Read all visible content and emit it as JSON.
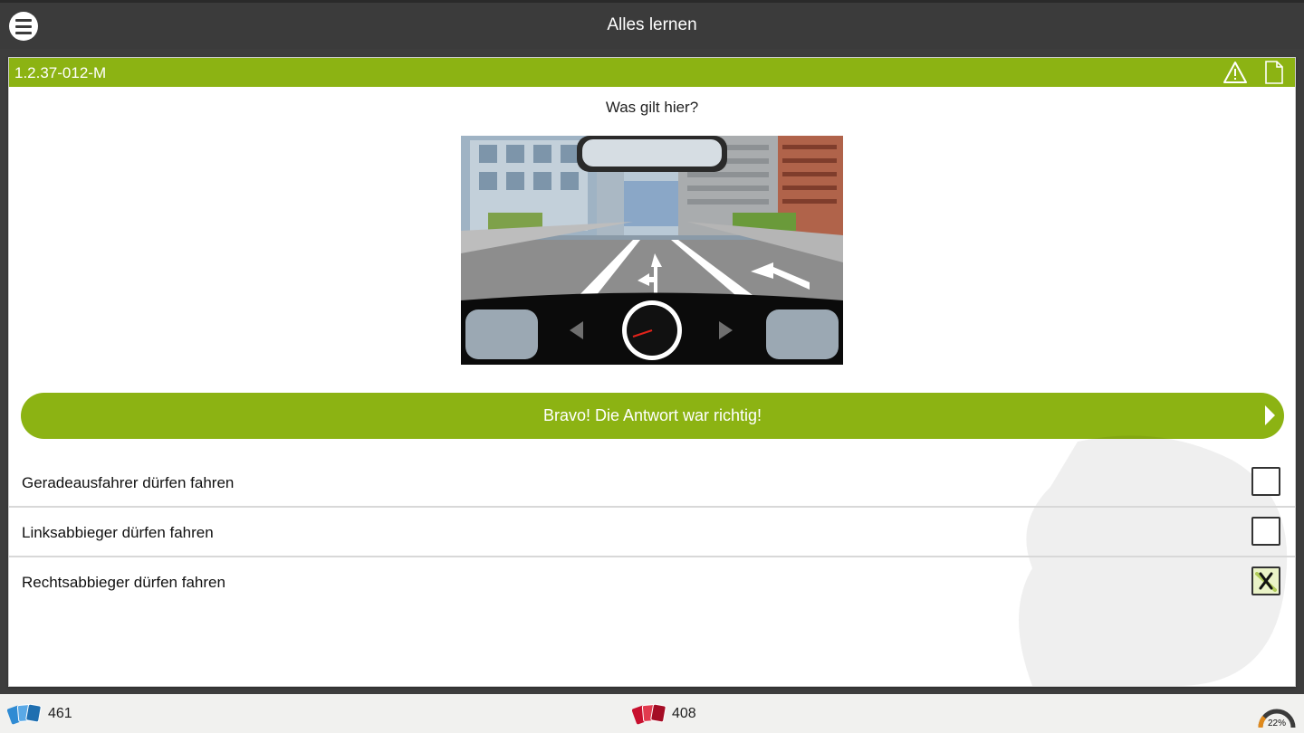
{
  "header": {
    "title": "Alles lernen"
  },
  "question": {
    "id": "1.2.37-012-M",
    "text": "Was gilt hier?",
    "feedback": "Bravo! Die Antwort war richtig!",
    "answers": [
      {
        "label": "Geradeausfahrer dürfen fahren",
        "checked": false
      },
      {
        "label": "Linksabbieger dürfen fahren",
        "checked": false
      },
      {
        "label": "Rechtsabbieger dürfen fahren",
        "checked": true
      }
    ]
  },
  "footer": {
    "learned_count": "461",
    "wrong_count": "408",
    "progress": "22%",
    "progress_value": 0.22
  },
  "colors": {
    "accent": "#8cb313",
    "topbar": "#3b3b3b"
  }
}
